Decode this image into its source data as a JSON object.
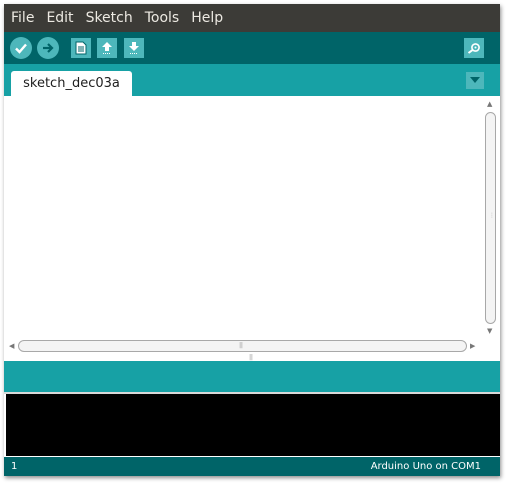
{
  "menu": {
    "items": [
      "File",
      "Edit",
      "Sketch",
      "Tools",
      "Help"
    ]
  },
  "toolbar": {
    "buttons": [
      {
        "name": "verify",
        "icon": "check-icon"
      },
      {
        "name": "upload",
        "icon": "arrow-right-icon"
      },
      {
        "name": "new",
        "icon": "document-icon"
      },
      {
        "name": "open",
        "icon": "arrow-up-icon"
      },
      {
        "name": "save",
        "icon": "arrow-down-icon"
      },
      {
        "name": "serial-monitor",
        "icon": "magnifier-icon"
      }
    ]
  },
  "tabs": {
    "items": [
      {
        "label": "sketch_dec03a"
      }
    ],
    "menu_icon": "triangle-down-icon"
  },
  "editor": {
    "content": ""
  },
  "console": {
    "content": ""
  },
  "status": {
    "line": "1",
    "board": "Arduino Uno on COM1"
  },
  "colors": {
    "menubar": "#3c3b37",
    "toolbar": "#006468",
    "tabbar": "#17a1a5",
    "button": "#4db7bb",
    "console": "#000000"
  }
}
